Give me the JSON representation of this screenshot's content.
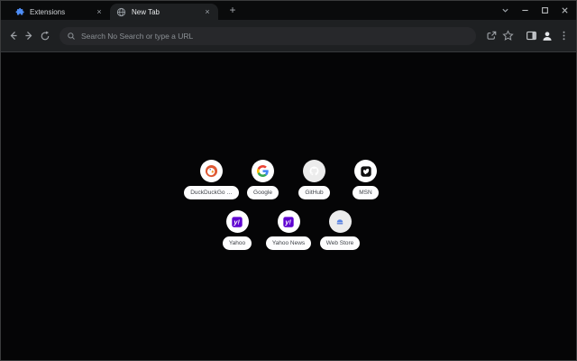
{
  "icons": {
    "close_glyph": "×",
    "plus_glyph": "+"
  },
  "tabstrip": {
    "tabs": [
      {
        "label": "Extensions",
        "icon": "puzzle-icon",
        "active": false
      },
      {
        "label": "New Tab",
        "icon": "globe-icon",
        "active": true
      }
    ]
  },
  "window_controls": {
    "buttons": [
      "tab-search",
      "minimize",
      "maximize",
      "close"
    ]
  },
  "toolbar": {
    "nav_icons": [
      "back-arrow",
      "forward-arrow",
      "reload"
    ],
    "omnibox": {
      "placeholder": "Search No Search or type a URL",
      "icon": "search-magnifier"
    },
    "right_icons": [
      "share",
      "bookmark-star",
      "side-panel",
      "profile-avatar",
      "kebab-menu"
    ]
  },
  "shortcuts": {
    "tiles": [
      {
        "label": "DuckDuckGo …",
        "icon": "duckduckgo-favicon"
      },
      {
        "label": "Google",
        "icon": "google-favicon"
      },
      {
        "label": "GitHub",
        "icon": "github-favicon"
      },
      {
        "label": "MSN",
        "icon": "msn-favicon"
      },
      {
        "label": "Yahoo",
        "icon": "yahoo-favicon"
      },
      {
        "label": "Yahoo News",
        "icon": "yahoo-news-favicon"
      },
      {
        "label": "Web Store",
        "icon": "web-store-favicon"
      }
    ]
  },
  "colors": {
    "tabstrip_bg": "#0a0b0c",
    "active_tab_bg": "#1e2022",
    "toolbar_bg": "#1e2022",
    "omnibox_bg": "#27282b",
    "content_bg": "#050506",
    "shortcut_pill_bg": "#fdfdfe",
    "shortcut_pill_text": "#3f4349",
    "omnibox_placeholder_text": "#8b9095",
    "duckduckgo_orange": "#de5833",
    "yahoo_purple": "#5f01d1",
    "webstore_blue": "#5b86e5",
    "extensions_puzzle_blue": "#4e8df6"
  }
}
